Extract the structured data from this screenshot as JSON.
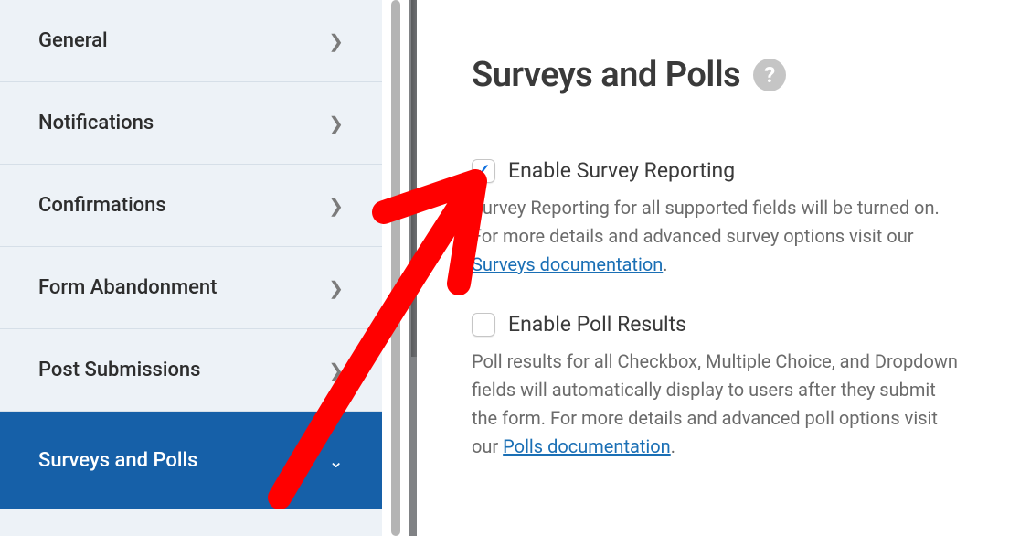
{
  "sidebar": {
    "items": [
      {
        "label": "General"
      },
      {
        "label": "Notifications"
      },
      {
        "label": "Confirmations"
      },
      {
        "label": "Form Abandonment"
      },
      {
        "label": "Post Submissions"
      },
      {
        "label": "Surveys and Polls"
      }
    ]
  },
  "panel": {
    "title": "Surveys and Polls",
    "options": [
      {
        "label": "Enable Survey Reporting",
        "desc_before": "Survey Reporting for all supported fields will be turned on. For more details and advanced survey options visit our ",
        "link_text": "Surveys documentation",
        "desc_after": "."
      },
      {
        "label": "Enable Poll Results",
        "desc_before": "Poll results for all Checkbox, Multiple Choice, and Dropdown fields will automatically display to users after they submit the form. For more details and advanced poll options visit our ",
        "link_text": "Polls documentation",
        "desc_after": "."
      }
    ]
  }
}
